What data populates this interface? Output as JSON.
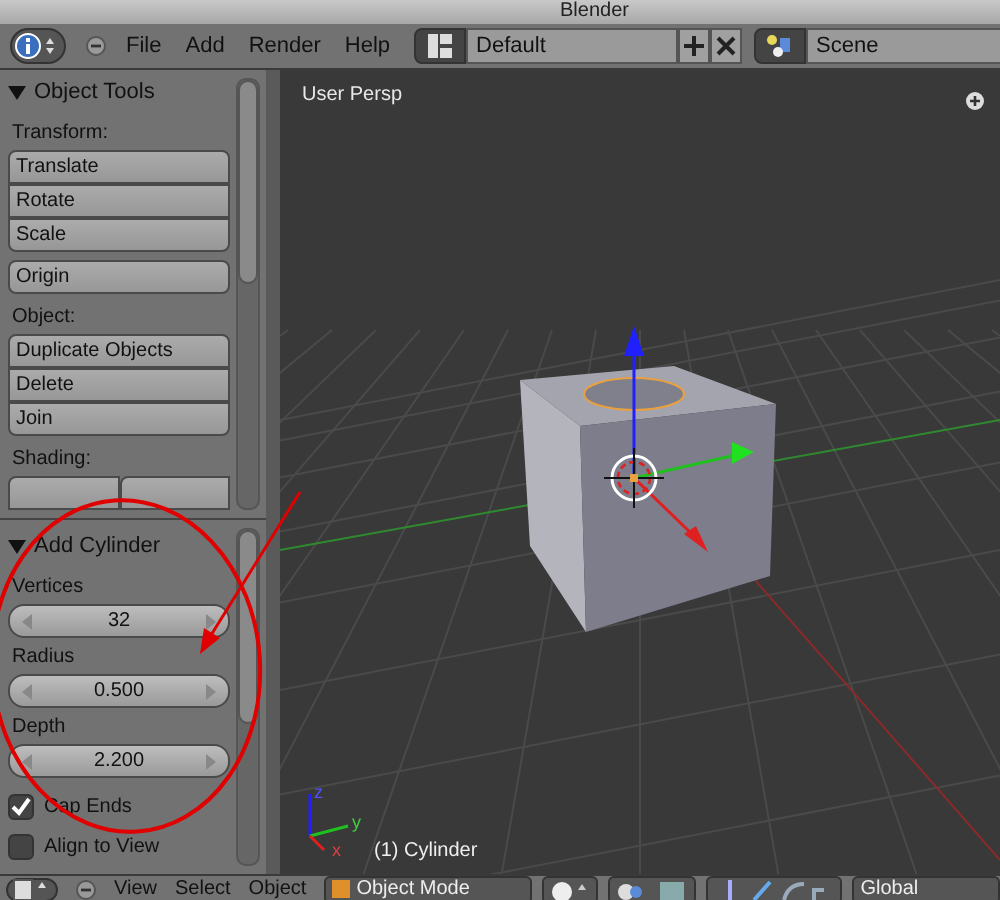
{
  "window": {
    "title": "Blender"
  },
  "header": {
    "menu": [
      "File",
      "Add",
      "Render",
      "Help"
    ],
    "screen_layout": "Default",
    "scene": "Scene"
  },
  "object_tools": {
    "title": "Object Tools",
    "expanded": true,
    "sections": [
      {
        "label": "Transform:",
        "buttons": [
          "Translate",
          "Rotate",
          "Scale"
        ]
      },
      {
        "buttons": [
          "Origin"
        ]
      },
      {
        "label": "Object:",
        "buttons": [
          "Duplicate Objects",
          "Delete",
          "Join"
        ]
      },
      {
        "label": "Shading:"
      }
    ]
  },
  "add_cylinder": {
    "title": "Add Cylinder",
    "expanded": true,
    "fields": [
      {
        "label": "Vertices",
        "value": "32"
      },
      {
        "label": "Radius",
        "value": "0.500"
      },
      {
        "label": "Depth",
        "value": "2.200"
      }
    ],
    "checkboxes": [
      {
        "label": "Cap Ends",
        "checked": true
      },
      {
        "label": "Align to View",
        "checked": false
      }
    ]
  },
  "viewport": {
    "view_label": "User Persp",
    "object_label": "(1) Cylinder",
    "axes": [
      "z",
      "y",
      "x"
    ]
  },
  "bottom_bar": {
    "menu": [
      "View",
      "Select",
      "Object"
    ],
    "mode": "Object Mode",
    "orientation": "Global"
  }
}
